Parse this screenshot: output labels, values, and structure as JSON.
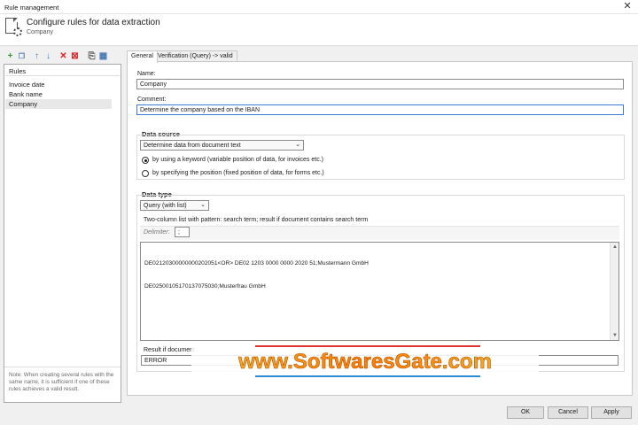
{
  "window": {
    "title": "Rule management",
    "close_glyph": "✕"
  },
  "header": {
    "title": "Configure rules for data extraction",
    "subtitle": "Company"
  },
  "toolbar": {
    "add": "+",
    "copy": "❐",
    "up": "↑",
    "down": "↓",
    "delete": "✕",
    "delete_all": "⊠",
    "export": "⎘",
    "grid": "▦"
  },
  "rules": {
    "heading": "Rules",
    "items": [
      "Invoice date",
      "Bank name",
      "Company"
    ],
    "selected_index": 2,
    "note": "Note: When creating several rules with the same name, it is sufficient if one of these rules achieves a valid result."
  },
  "tabs": [
    {
      "label": "General",
      "active": true
    },
    {
      "label": "Verification (Query) -> valid",
      "active": false
    }
  ],
  "general": {
    "name_label": "Name:",
    "name_value": "Company",
    "comment_label": "Comment:",
    "comment_value": "Determine the company based on the IBAN"
  },
  "data_source": {
    "title": "Data source",
    "combo_value": "Determine data from document text",
    "options": [
      {
        "label": "by using a keyword (variable position of data, for invoices etc.)",
        "checked": true
      },
      {
        "label": "by specifying the position (fixed position of data, for forms etc.)",
        "checked": false
      }
    ]
  },
  "data_type": {
    "title": "Data type",
    "combo_value": "Query (with list)",
    "description": "Two-column list with pattern: search term; result if document contains search term",
    "delimiter_label": "Delimiter:",
    "delimiter_value": ";",
    "list_lines": [
      "DE02120300000000202051<OR> DE02 1203 0000 0000 2020 51;Mustermann GmbH",
      "DE02500105170137075030;Musterfrau GmbH"
    ],
    "result_label": "Result if document",
    "result_value": "ERROR"
  },
  "watermark": {
    "text": "www.SoftwaresGate.com"
  },
  "buttons": {
    "ok": "OK",
    "cancel": "Cancel",
    "apply": "Apply"
  }
}
